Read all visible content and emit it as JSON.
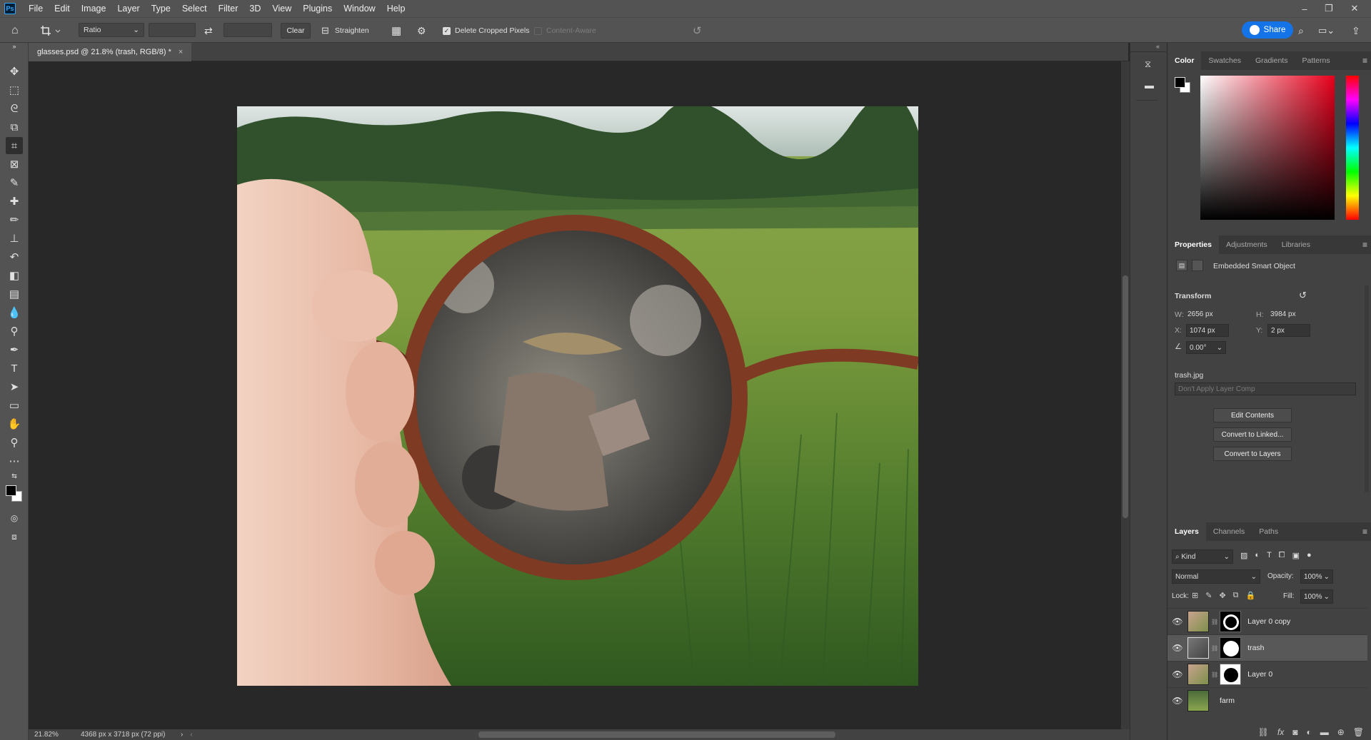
{
  "app": {
    "logo": "Ps"
  },
  "menu": [
    "File",
    "Edit",
    "Image",
    "Layer",
    "Type",
    "Select",
    "Filter",
    "3D",
    "View",
    "Plugins",
    "Window",
    "Help"
  ],
  "window_controls": {
    "minimize": "–",
    "restore": "❐",
    "close": "✕"
  },
  "options_bar": {
    "ratio_label": "Ratio",
    "clear_label": "Clear",
    "straighten_label": "Straighten",
    "delete_cropped_label": "Delete Cropped Pixels",
    "delete_cropped_checked": true,
    "content_aware_label": "Content-Aware",
    "share_label": "Share"
  },
  "document": {
    "tab_title": "glasses.psd @ 21.8% (trash, RGB/8) *",
    "close_symbol": "×"
  },
  "status": {
    "zoom": "21.82%",
    "info": "4368 px x 3718 px (72 ppi)"
  },
  "color_panel": {
    "tabs": [
      "Color",
      "Swatches",
      "Gradients",
      "Patterns"
    ],
    "active": 0,
    "fg": "#000000",
    "bg": "#ffffff"
  },
  "properties_panel": {
    "tabs": [
      "Properties",
      "Adjustments",
      "Libraries"
    ],
    "object_type": "Embedded Smart Object",
    "transform_label": "Transform",
    "w_label": "W:",
    "w_value": "2656 px",
    "h_label": "H:",
    "h_value": "3984 px",
    "x_label": "X:",
    "x_value": "1074 px",
    "y_label": "Y:",
    "y_value": "2 px",
    "angle_value": "0.00°",
    "source_file": "trash.jpg",
    "layer_comp_placeholder": "Don't Apply Layer Comp",
    "buttons": [
      "Edit Contents",
      "Convert to Linked...",
      "Convert to Layers"
    ]
  },
  "layers_panel": {
    "tabs": [
      "Layers",
      "Channels",
      "Paths"
    ],
    "filter_label": "Kind",
    "blend_mode": "Normal",
    "opacity_label": "Opacity:",
    "opacity_value": "100%",
    "lock_label": "Lock:",
    "fill_label": "Fill:",
    "fill_value": "100%",
    "layers": [
      {
        "name": "Layer 0 copy",
        "selected": false
      },
      {
        "name": "trash",
        "selected": true
      },
      {
        "name": "Layer 0",
        "selected": false
      },
      {
        "name": "farm",
        "selected": false
      }
    ]
  }
}
